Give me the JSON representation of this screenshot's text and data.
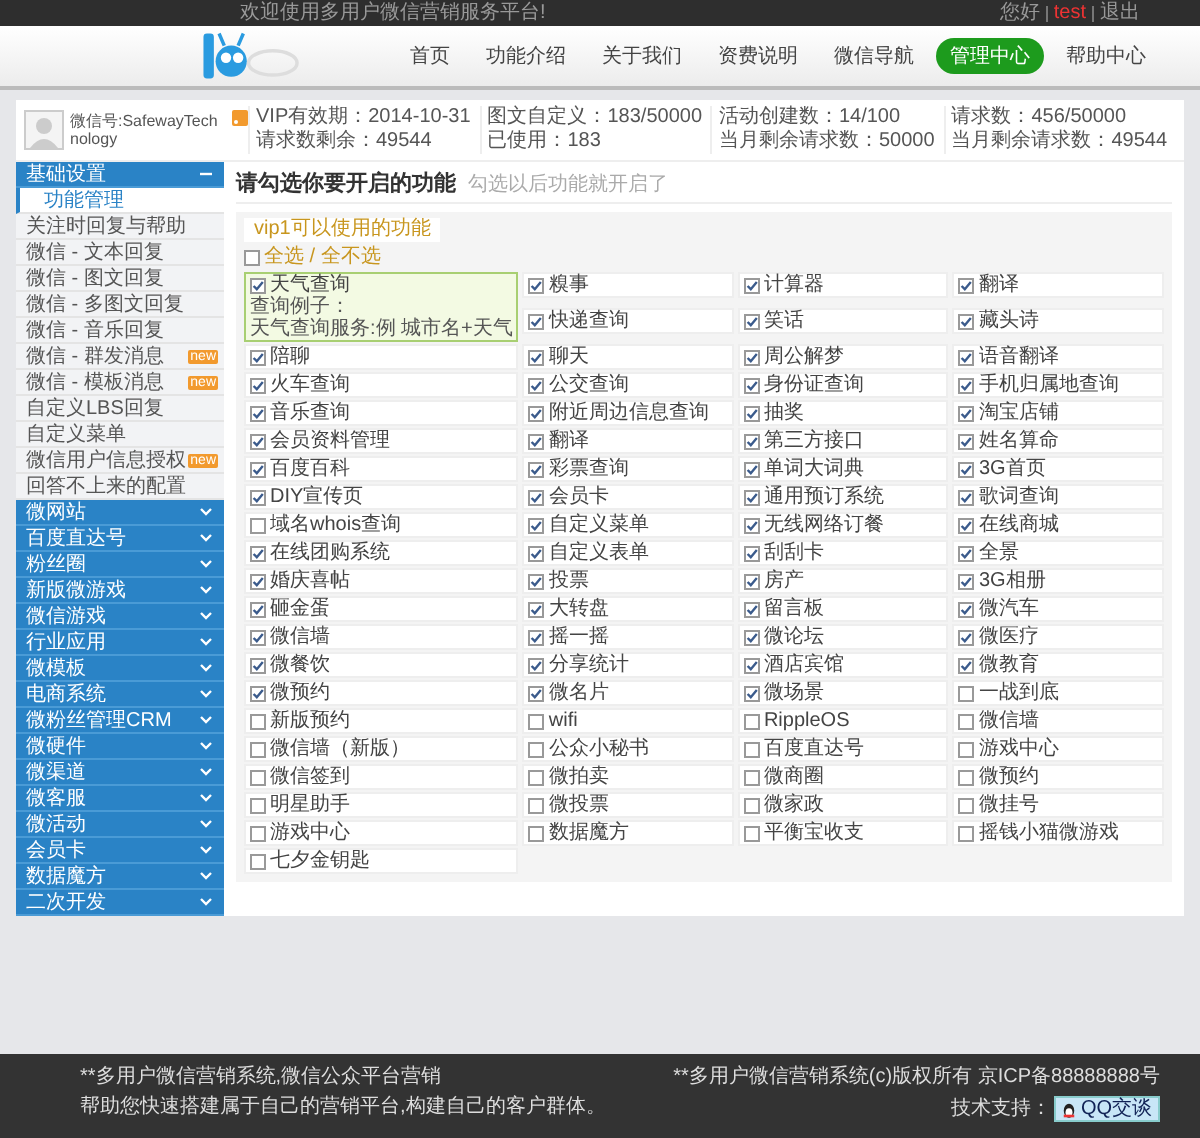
{
  "topbar": {
    "welcome": "欢迎使用多用户微信营销服务平台!",
    "links": [
      {
        "label": "您好",
        "highlight": false
      },
      {
        "label": "test",
        "highlight": true
      },
      {
        "label": "退出",
        "highlight": false
      }
    ]
  },
  "nav": [
    {
      "label": "首页",
      "selected": false
    },
    {
      "label": "功能介绍",
      "selected": false
    },
    {
      "label": "关于我们",
      "selected": false
    },
    {
      "label": "资费说明",
      "selected": false
    },
    {
      "label": "微信导航",
      "selected": false
    },
    {
      "label": "管理中心",
      "selected": true
    },
    {
      "label": "帮助中心",
      "selected": false
    }
  ],
  "account": {
    "name": "微信号:SafewayTechnology",
    "stats": [
      [
        "VIP有效期：2014-10-31",
        "请求数剩余：49544"
      ],
      [
        "图文自定义：183/50000",
        "已使用：183"
      ],
      [
        "活动创建数：14/100",
        "当月剩余请求数：50000"
      ],
      [
        "请求数：456/50000",
        "当月剩余请求数：49544"
      ]
    ]
  },
  "sidebar": [
    {
      "label": "基础设置",
      "expanded": true,
      "children": [
        {
          "label": "功能管理",
          "selected": true
        },
        {
          "label": "关注时回复与帮助",
          "selected": false
        },
        {
          "label": "微信 - 文本回复",
          "selected": false
        },
        {
          "label": "微信 - 图文回复",
          "selected": false
        },
        {
          "label": "微信 - 多图文回复",
          "selected": false
        },
        {
          "label": "微信 - 音乐回复",
          "selected": false
        },
        {
          "label": "微信 - 群发消息",
          "selected": false,
          "badge": "new"
        },
        {
          "label": "微信 - 模板消息",
          "selected": false,
          "badge": "new"
        },
        {
          "label": "自定义LBS回复",
          "selected": false
        },
        {
          "label": "自定义菜单",
          "selected": false
        },
        {
          "label": "微信用户信息授权",
          "selected": false,
          "badge": "new"
        },
        {
          "label": "回答不上来的配置",
          "selected": false
        }
      ]
    },
    {
      "label": "微网站",
      "expanded": false
    },
    {
      "label": "百度直达号",
      "expanded": false
    },
    {
      "label": "粉丝圈",
      "expanded": false
    },
    {
      "label": "新版微游戏",
      "expanded": false
    },
    {
      "label": "微信游戏",
      "expanded": false
    },
    {
      "label": "行业应用",
      "expanded": false
    },
    {
      "label": "微模板",
      "expanded": false
    },
    {
      "label": "电商系统",
      "expanded": false
    },
    {
      "label": "微粉丝管理CRM",
      "expanded": false
    },
    {
      "label": "微硬件",
      "expanded": false
    },
    {
      "label": "微渠道",
      "expanded": false
    },
    {
      "label": "微客服",
      "expanded": false
    },
    {
      "label": "微活动",
      "expanded": false
    },
    {
      "label": "会员卡",
      "expanded": false
    },
    {
      "label": "数据魔方",
      "expanded": false
    },
    {
      "label": "二次开发",
      "expanded": false
    }
  ],
  "panel": {
    "title": "请勾选你要开启的功能",
    "hint": "勾选以后功能就开启了",
    "group_tab": "vip1可以使用的功能",
    "select_all": "全选 / 全不选",
    "select_all_checked": false,
    "items": [
      {
        "label": "天气查询",
        "checked": true,
        "tip": [
          "查询例子：",
          "天气查询服务:例 城市名+天气"
        ]
      },
      {
        "label": "糗事",
        "checked": true
      },
      {
        "label": "计算器",
        "checked": true
      },
      {
        "label": "翻译",
        "checked": true
      },
      {
        "label": "快递查询",
        "checked": true
      },
      {
        "label": "笑话",
        "checked": true
      },
      {
        "label": "藏头诗",
        "checked": true
      },
      {
        "label": "陪聊",
        "checked": true
      },
      {
        "label": "聊天",
        "checked": true
      },
      {
        "label": "周公解梦",
        "checked": true
      },
      {
        "label": "语音翻译",
        "checked": true
      },
      {
        "label": "火车查询",
        "checked": true
      },
      {
        "label": "公交查询",
        "checked": true
      },
      {
        "label": "身份证查询",
        "checked": true
      },
      {
        "label": "手机归属地查询",
        "checked": true
      },
      {
        "label": "音乐查询",
        "checked": true
      },
      {
        "label": "附近周边信息查询",
        "checked": true
      },
      {
        "label": "抽奖",
        "checked": true
      },
      {
        "label": "淘宝店铺",
        "checked": true
      },
      {
        "label": "会员资料管理",
        "checked": true
      },
      {
        "label": "翻译",
        "checked": true
      },
      {
        "label": "第三方接口",
        "checked": true
      },
      {
        "label": "姓名算命",
        "checked": true
      },
      {
        "label": "百度百科",
        "checked": true
      },
      {
        "label": "彩票查询",
        "checked": true
      },
      {
        "label": "单词大词典",
        "checked": true
      },
      {
        "label": "3G首页",
        "checked": true
      },
      {
        "label": "DIY宣传页",
        "checked": true
      },
      {
        "label": "会员卡",
        "checked": true
      },
      {
        "label": "通用预订系统",
        "checked": true
      },
      {
        "label": "歌词查询",
        "checked": true
      },
      {
        "label": "域名whois查询",
        "checked": false
      },
      {
        "label": "自定义菜单",
        "checked": true
      },
      {
        "label": "无线网络订餐",
        "checked": true
      },
      {
        "label": "在线商城",
        "checked": true
      },
      {
        "label": "在线团购系统",
        "checked": true
      },
      {
        "label": "自定义表单",
        "checked": true
      },
      {
        "label": "刮刮卡",
        "checked": true
      },
      {
        "label": "全景",
        "checked": true
      },
      {
        "label": "婚庆喜帖",
        "checked": true
      },
      {
        "label": "投票",
        "checked": true
      },
      {
        "label": "房产",
        "checked": true
      },
      {
        "label": "3G相册",
        "checked": true
      },
      {
        "label": "砸金蛋",
        "checked": true
      },
      {
        "label": "大转盘",
        "checked": true
      },
      {
        "label": "留言板",
        "checked": true
      },
      {
        "label": "微汽车",
        "checked": true
      },
      {
        "label": "微信墙",
        "checked": true
      },
      {
        "label": "摇一摇",
        "checked": true
      },
      {
        "label": "微论坛",
        "checked": true
      },
      {
        "label": "微医疗",
        "checked": true
      },
      {
        "label": "微餐饮",
        "checked": true
      },
      {
        "label": "分享统计",
        "checked": true
      },
      {
        "label": "酒店宾馆",
        "checked": true
      },
      {
        "label": "微教育",
        "checked": true
      },
      {
        "label": "微预约",
        "checked": true
      },
      {
        "label": "微名片",
        "checked": true
      },
      {
        "label": "微场景",
        "checked": true
      },
      {
        "label": "一战到底",
        "checked": false
      },
      {
        "label": "新版预约",
        "checked": false
      },
      {
        "label": "wifi",
        "checked": false
      },
      {
        "label": "RippleOS",
        "checked": false
      },
      {
        "label": "微信墙",
        "checked": false
      },
      {
        "label": "微信墙（新版）",
        "checked": false
      },
      {
        "label": "公众小秘书",
        "checked": false
      },
      {
        "label": "百度直达号",
        "checked": false
      },
      {
        "label": "游戏中心",
        "checked": false
      },
      {
        "label": "微信签到",
        "checked": false
      },
      {
        "label": "微拍卖",
        "checked": false
      },
      {
        "label": "微商圈",
        "checked": false
      },
      {
        "label": "微预约",
        "checked": false
      },
      {
        "label": "明星助手",
        "checked": false
      },
      {
        "label": "微投票",
        "checked": false
      },
      {
        "label": "微家政",
        "checked": false
      },
      {
        "label": "微挂号",
        "checked": false
      },
      {
        "label": "游戏中心",
        "checked": false
      },
      {
        "label": "数据魔方",
        "checked": false
      },
      {
        "label": "平衡宝收支",
        "checked": false
      },
      {
        "label": "摇钱小猫微游戏",
        "checked": false
      },
      {
        "label": "七夕金钥匙",
        "checked": false
      }
    ]
  },
  "footer": {
    "left": [
      "**多用户微信营销系统,微信公众平台营销",
      "帮助您快速搭建属于自己的营销平台,构建自己的客户群体。"
    ],
    "copyright": "**多用户微信营销系统(c)版权所有 京ICP备88888888号",
    "support_label": "技术支持：",
    "qq_button": "QQ交谈"
  }
}
